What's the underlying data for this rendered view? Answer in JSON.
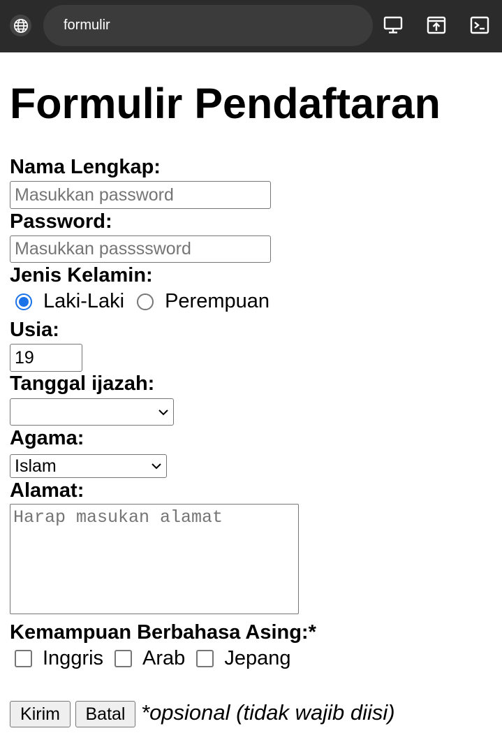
{
  "browser": {
    "url_text": "formulir",
    "globe_icon": "globe-icon",
    "desktop_icon": "desktop-icon",
    "open_icon": "open-in-new-icon",
    "terminal_icon": "terminal-icon"
  },
  "form": {
    "title": "Formulir Pendaftaran",
    "name_label": "Nama Lengkap:",
    "name_placeholder": "Masukkan password",
    "password_label": "Password:",
    "password_placeholder": "Masukkan passssword",
    "gender_label": "Jenis Kelamin:",
    "gender_options": [
      "Laki-Laki",
      "Perempuan"
    ],
    "gender_selected": "Laki-Laki",
    "age_label": "Usia:",
    "age_value": "19",
    "ijazah_label": "Tanggal ijazah:",
    "ijazah_value": "",
    "religion_label": "Agama:",
    "religion_value": "Islam",
    "address_label": "Alamat:",
    "address_placeholder": "Harap masukan alamat",
    "language_label": "Kemampuan Berbahasa Asing:*",
    "languages": [
      "Inggris",
      "Arab",
      "Jepang"
    ],
    "submit_label": "Kirim",
    "cancel_label": "Batal",
    "optional_note": "*opsional (tidak wajib diisi)"
  },
  "colors": {
    "topbar": "#2b2b2b",
    "url_bar": "#3b3b3b",
    "accent": "#1a73e8"
  }
}
